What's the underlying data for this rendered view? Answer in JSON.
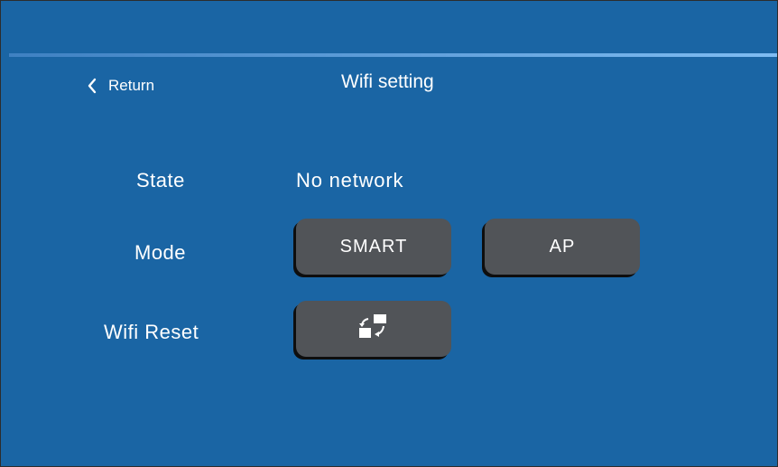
{
  "header": {
    "return_label": "Return",
    "title": "Wifi setting"
  },
  "rows": {
    "state": {
      "label": "State",
      "value": "No network"
    },
    "mode": {
      "label": "Mode",
      "options": [
        "SMART",
        "AP"
      ]
    },
    "reset": {
      "label": "Wifi Reset",
      "icon": "reset-icon"
    }
  },
  "colors": {
    "background": "#1a65a4",
    "button": "#515458",
    "text": "#ffffff"
  }
}
